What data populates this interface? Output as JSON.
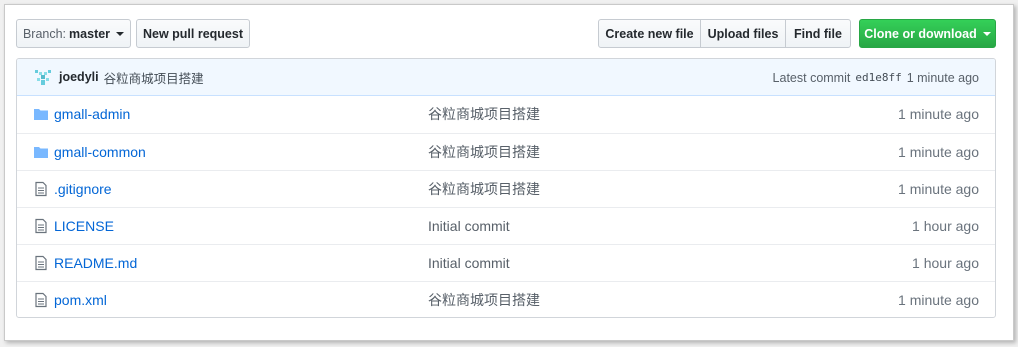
{
  "toolbar": {
    "branch_prefix": "Branch:",
    "branch_name": "master",
    "new_pr_label": "New pull request",
    "create_file_label": "Create new file",
    "upload_files_label": "Upload files",
    "find_file_label": "Find file",
    "clone_label": "Clone or download"
  },
  "commit": {
    "author": "joedyli",
    "message": "谷粒商城项目搭建",
    "latest_label": "Latest commit",
    "sha": "ed1e8ff",
    "age": "1 minute ago"
  },
  "files": [
    {
      "type": "folder",
      "name": "gmall-admin",
      "message": "谷粒商城项目搭建",
      "age": "1 minute ago"
    },
    {
      "type": "folder",
      "name": "gmall-common",
      "message": "谷粒商城项目搭建",
      "age": "1 minute ago"
    },
    {
      "type": "file",
      "name": ".gitignore",
      "message": "谷粒商城项目搭建",
      "age": "1 minute ago"
    },
    {
      "type": "file",
      "name": "LICENSE",
      "message": "Initial commit",
      "age": "1 hour ago"
    },
    {
      "type": "file",
      "name": "README.md",
      "message": "Initial commit",
      "age": "1 hour ago"
    },
    {
      "type": "file",
      "name": "pom.xml",
      "message": "谷粒商城项目搭建",
      "age": "1 minute ago"
    }
  ],
  "colors": {
    "link": "#0366d6",
    "clone_green": "#28a745",
    "commit_bar_bg": "#f1f8ff",
    "folder_icon": "#79b8ff"
  }
}
